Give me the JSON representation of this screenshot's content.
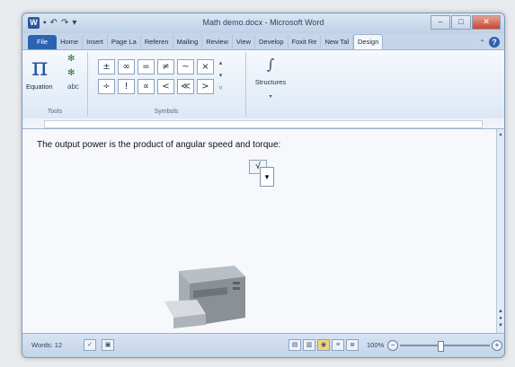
{
  "window": {
    "title": "Math demo.docx - Microsoft Word"
  },
  "qat": {
    "logo": "W"
  },
  "tabs": [
    "File",
    "Home",
    "Insert",
    "Page La",
    "Referen",
    "Mailing",
    "Review",
    "View",
    "Develop",
    "Foxit Re",
    "New Tal",
    "Design"
  ],
  "ribbon": {
    "equation_label": "Equation",
    "tools_label": "Tools",
    "symbols_label": "Symbols",
    "structures_label": "Structures",
    "symbols_row1": [
      "±",
      "∞",
      "=",
      "≠",
      "~",
      "×"
    ],
    "symbols_row2": [
      "÷",
      "!",
      "∝",
      "<",
      "≪",
      ">"
    ]
  },
  "document": {
    "text": "The output power is the product of angular speed and torque:"
  },
  "status": {
    "words": "Words: 12",
    "zoom": "100%"
  }
}
